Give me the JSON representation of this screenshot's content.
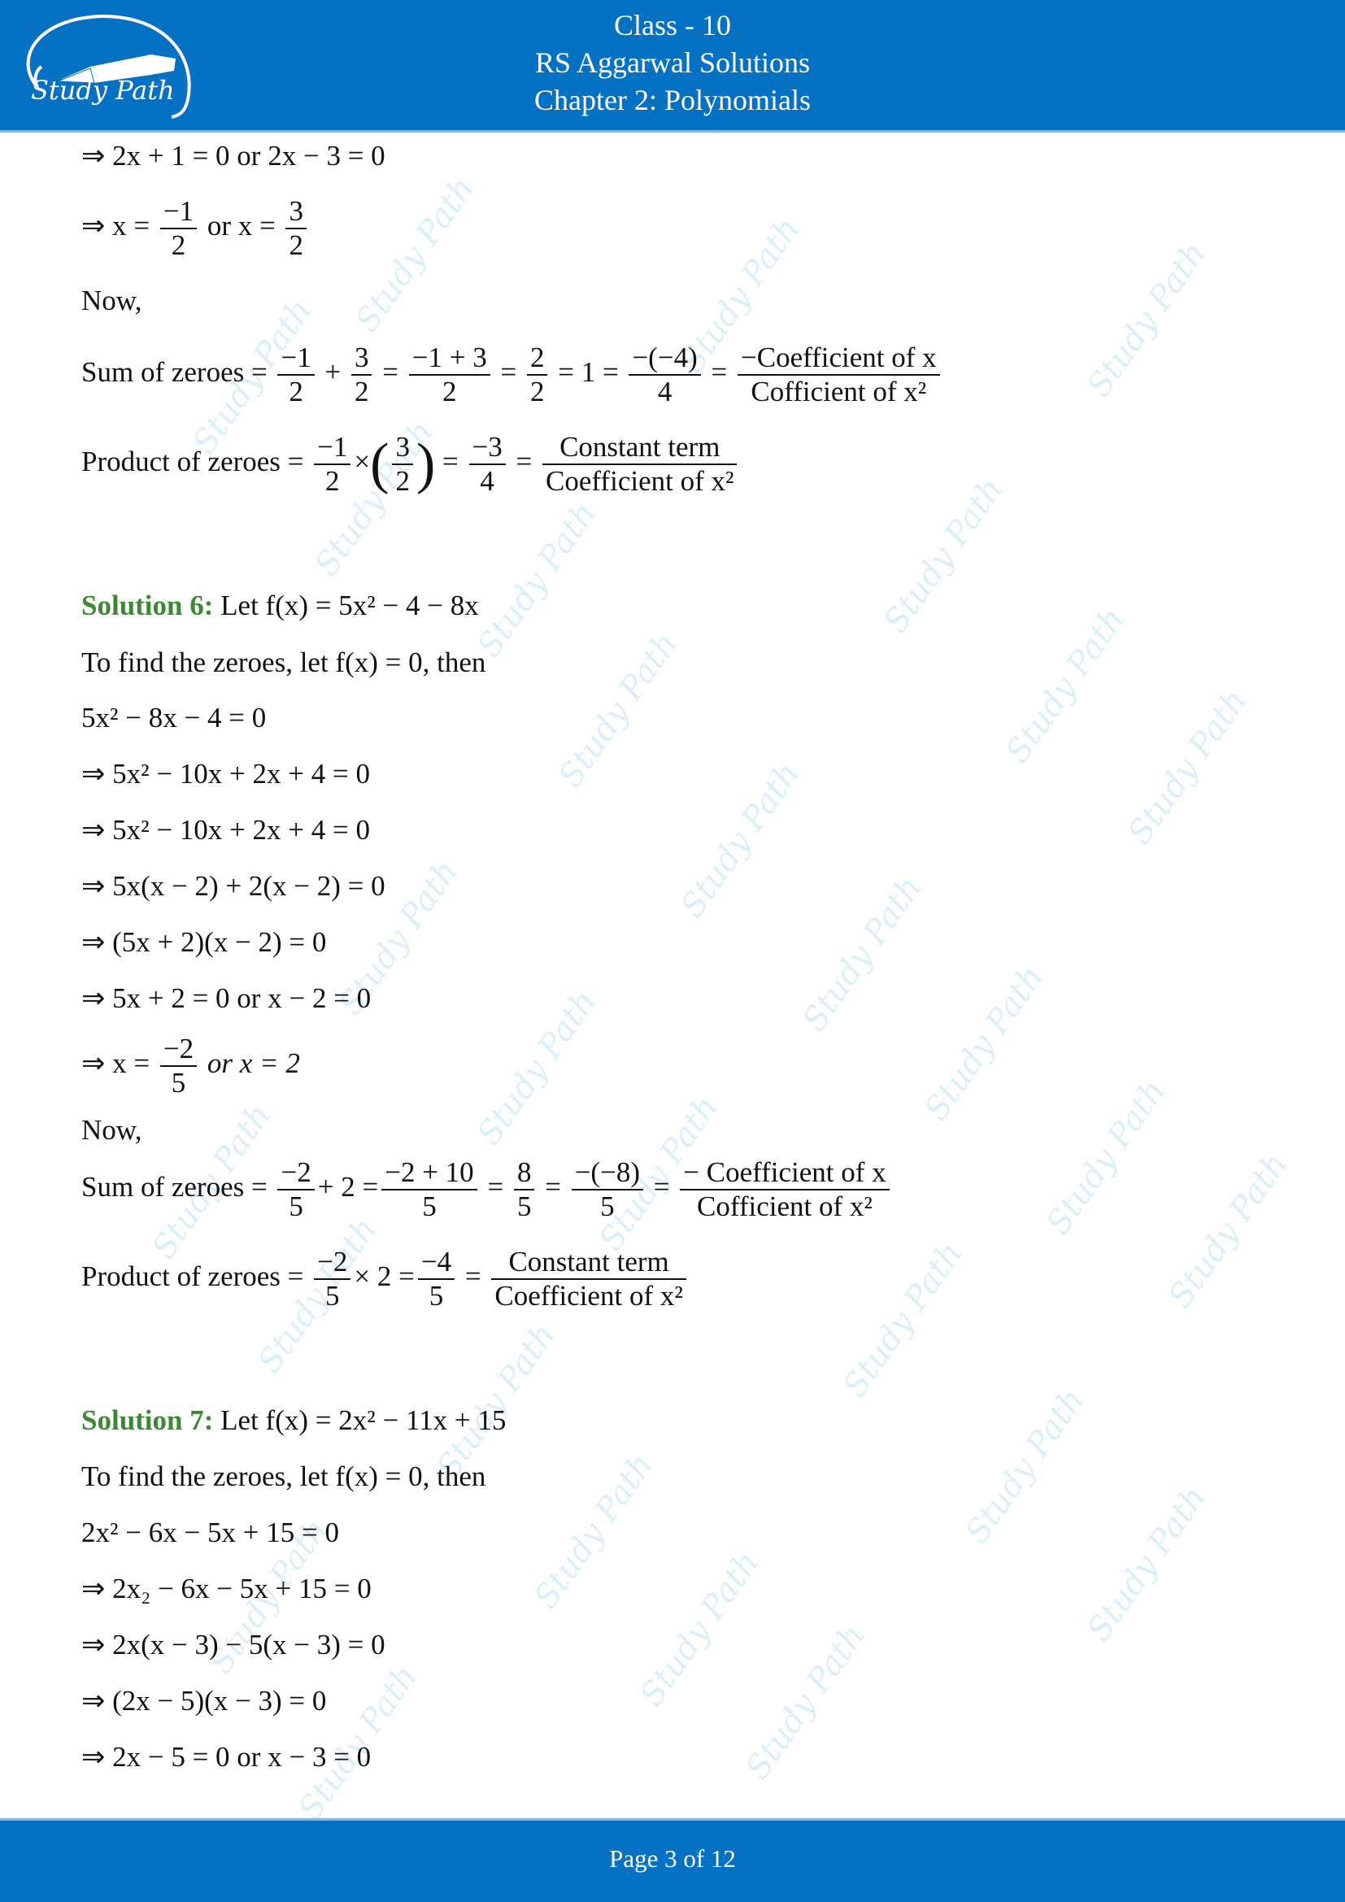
{
  "header": {
    "logo_text": "Study Path",
    "line1": "Class - 10",
    "line2": "RS Aggarwal Solutions",
    "line3": "Chapter 2: Polynomials"
  },
  "colors": {
    "brand_blue": "#0571c2",
    "solution_green": "#3a8a2f",
    "watermark": "#bfe3f7"
  },
  "watermark_text": "Study Path",
  "top": {
    "l1": "⇒ 2x + 1 = 0  or  2x − 3 = 0",
    "l2_prefix": "⇒ x = ",
    "l2_f1_num": "−1",
    "l2_f1_den": "2",
    "l2_mid": " or  x = ",
    "l2_f2_num": "3",
    "l2_f2_den": "2",
    "now": "Now,",
    "sum_label": "Sum of zeroes = ",
    "sum": [
      {
        "num": "−1",
        "den": "2"
      },
      {
        "op": "+"
      },
      {
        "num": "3",
        "den": "2"
      },
      {
        "op": "="
      },
      {
        "num": "−1 + 3",
        "den": "2"
      },
      {
        "op": "="
      },
      {
        "num": "2",
        "den": "2"
      },
      {
        "op": " = 1 ="
      },
      {
        "num": "−(−4)",
        "den": "4"
      },
      {
        "op": "="
      },
      {
        "num": "−Coefficient of x",
        "den": "Cofficient of x²"
      }
    ],
    "prod_label": "Product of zeroes  = ",
    "prod": {
      "f1_num": "−1",
      "f1_den": "2",
      "times": "×",
      "f2_num": "3",
      "f2_den": "2",
      "f3_num": "−3",
      "f3_den": "4",
      "f4_num": "Constant term",
      "f4_den": "Coefficient of x²"
    }
  },
  "solution6": {
    "title": "Solution 6:",
    "intro": " Let f(x) =  5x² − 4 − 8x",
    "find": "To find the zeroes, let f(x) = 0, then",
    "steps": [
      "5x² − 8x − 4 = 0",
      "⇒ 5x² − 10x + 2x + 4 = 0",
      "⇒ 5x² − 10x  +  2x + 4 = 0",
      "⇒ 5x(x − 2) + 2(x − 2) = 0",
      "⇒ (5x + 2)(x − 2) = 0",
      "⇒ 5x + 2 = 0 or x − 2 = 0"
    ],
    "root_prefix": "⇒ x = ",
    "root_num": "−2",
    "root_den": "5",
    "root_suffix": " or x = 2",
    "now": "Now,",
    "sum_label": "Sum of zeroes = ",
    "sum": {
      "f1_num": "−2",
      "f1_den": "5",
      "plus2": "+ 2 =",
      "f2_num": "−2 + 10",
      "f2_den": "5",
      "f3_num": "8",
      "f3_den": "5",
      "f4_num": "−(−8)",
      "f4_den": "5",
      "f5_num": "− Coefficient of x",
      "f5_den": "Cofficient of x²"
    },
    "prod_label": "Product of zeroes = ",
    "prod": {
      "f1_num": "−2",
      "f1_den": "5",
      "times2": "× 2 =",
      "f2_num": "−4",
      "f2_den": "5",
      "f3_num": "Constant term",
      "f3_den": "Coefficient of x²"
    }
  },
  "solution7": {
    "title": "Solution 7:",
    "intro": " Let f(x) = 2x² − 11x + 15",
    "find": "To find the zeroes, let f(x) = 0, then",
    "steps": [
      "2x² − 6x −  5x + 15 = 0",
      "⇒ 2x₂ − 6x − 5x + 15 = 0",
      "⇒ 2x(x − 3) − 5(x − 3) = 0",
      "⇒ (2x − 5)(x − 3) = 0",
      "⇒ 2x − 5 = 0 or x − 3 = 0"
    ]
  },
  "footer": {
    "page_label": "Page 3 of 12"
  }
}
